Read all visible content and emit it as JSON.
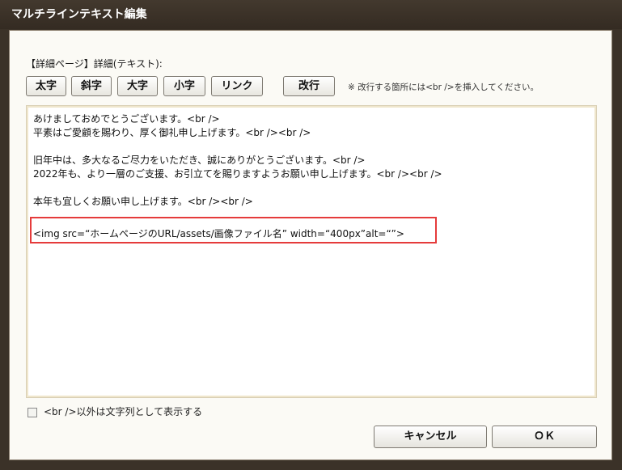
{
  "window": {
    "title": "マルチラインテキスト編集"
  },
  "section_label": "【詳細ページ】詳細(テキスト):",
  "toolbar": {
    "buttons": [
      "太字",
      "斜字",
      "大字",
      "小字",
      "リンク"
    ],
    "newline_button": "改行",
    "note": "※ 改行する箇所には<br />を挿入してください。"
  },
  "editor": {
    "lines": [
      "あけましておめでとうございます。<br />",
      "平素はご愛顧を賜わり、厚く御礼申し上げます。<br /><br />",
      "",
      "旧年中は、多大なるご尽力をいただき、誠にありがとうございます。<br />",
      "2022年も、より一層のご支援、お引立てを賜りますようお願い申し上げます。<br /><br />",
      "",
      "本年も宜しくお願い申し上げます。<br /><br />",
      "",
      "<img src=“ホームページのURL/assets/画像ファイル名” width=“400px”alt=“”>"
    ]
  },
  "checkbox": {
    "label": "<br />以外は文字列として表示する",
    "checked": false
  },
  "buttons": {
    "cancel": "キャンセル",
    "ok": "ＯＫ"
  },
  "colors": {
    "titlebar": "#3b3228",
    "highlight_border": "#e53b3b"
  }
}
